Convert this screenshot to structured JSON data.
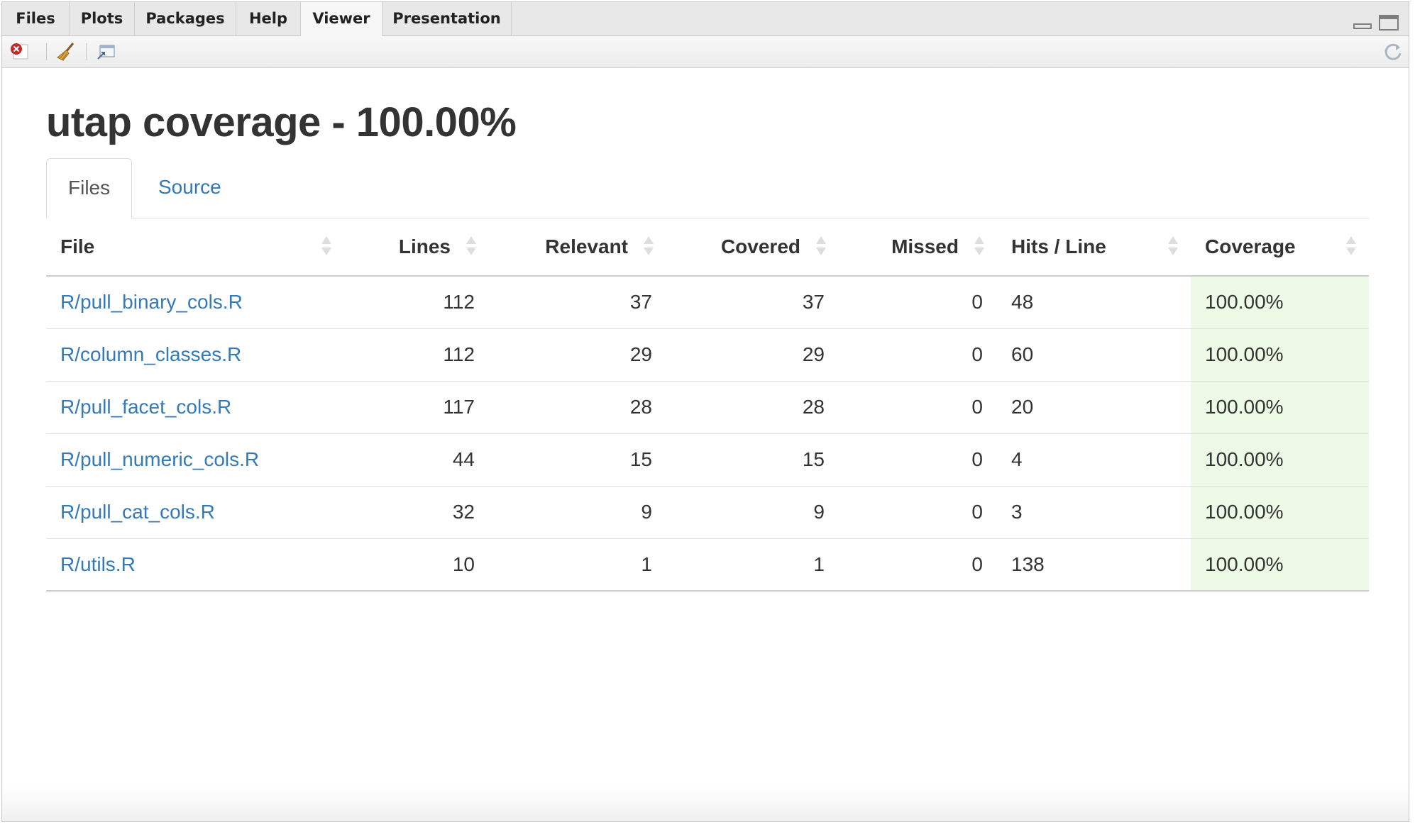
{
  "pane_tabs": [
    "Files",
    "Plots",
    "Packages",
    "Help",
    "Viewer",
    "Presentation"
  ],
  "active_pane_tab": "Viewer",
  "toolbar": {
    "icons": [
      "remove-icon",
      "broom-icon",
      "popout-icon",
      "refresh-icon"
    ]
  },
  "page": {
    "title": "utap coverage - 100.00%"
  },
  "tabs": {
    "files": "Files",
    "source": "Source"
  },
  "table": {
    "headers": {
      "file": "File",
      "lines": "Lines",
      "relevant": "Relevant",
      "covered": "Covered",
      "missed": "Missed",
      "hits": "Hits / Line",
      "coverage": "Coverage"
    },
    "rows": [
      {
        "file": "R/pull_binary_cols.R",
        "lines": "112",
        "relevant": "37",
        "covered": "37",
        "missed": "0",
        "hits": "48",
        "coverage": "100.00%"
      },
      {
        "file": "R/column_classes.R",
        "lines": "112",
        "relevant": "29",
        "covered": "29",
        "missed": "0",
        "hits": "60",
        "coverage": "100.00%"
      },
      {
        "file": "R/pull_facet_cols.R",
        "lines": "117",
        "relevant": "28",
        "covered": "28",
        "missed": "0",
        "hits": "20",
        "coverage": "100.00%"
      },
      {
        "file": "R/pull_numeric_cols.R",
        "lines": "44",
        "relevant": "15",
        "covered": "15",
        "missed": "0",
        "hits": "4",
        "coverage": "100.00%"
      },
      {
        "file": "R/pull_cat_cols.R",
        "lines": "32",
        "relevant": "9",
        "covered": "9",
        "missed": "0",
        "hits": "3",
        "coverage": "100.00%"
      },
      {
        "file": "R/utils.R",
        "lines": "10",
        "relevant": "1",
        "covered": "1",
        "missed": "0",
        "hits": "138",
        "coverage": "100.00%"
      }
    ]
  },
  "colors": {
    "link": "#337ab7",
    "coverage_cell": "#edfbe6"
  }
}
